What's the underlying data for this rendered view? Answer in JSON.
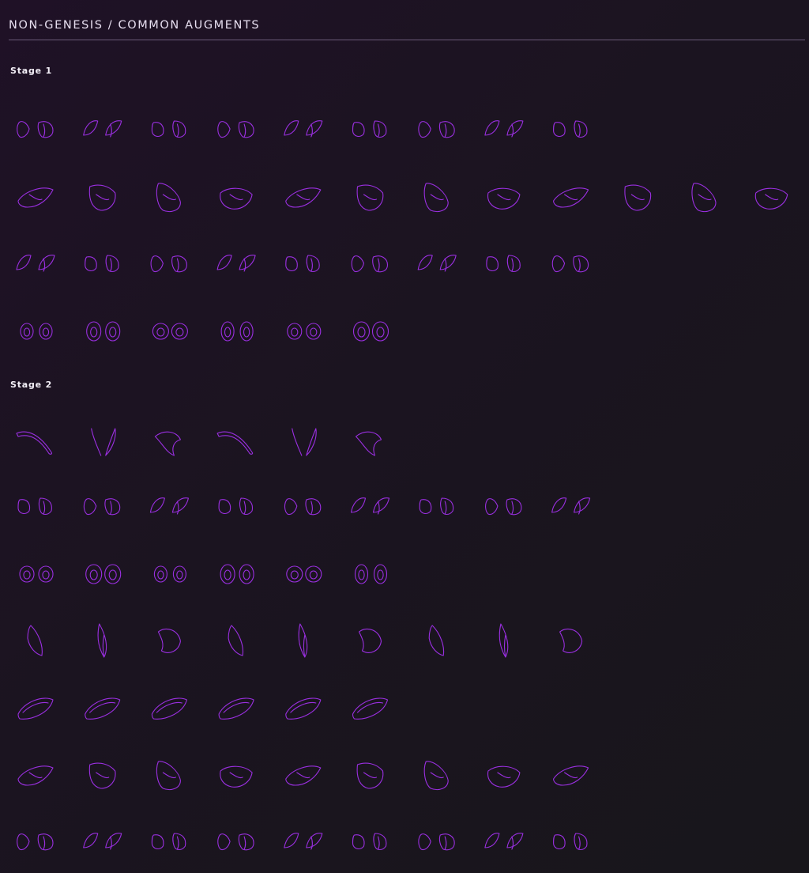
{
  "header": {
    "title": "NON-GENESIS / COMMON AUGMENTS"
  },
  "stages": [
    {
      "label": "Stage 1",
      "rows": [
        {
          "kind": "ear-pair",
          "count": 9
        },
        {
          "kind": "blob",
          "count": 12
        },
        {
          "kind": "ear-pair",
          "count": 9
        },
        {
          "kind": "eye-pair",
          "count": 6
        }
      ]
    },
    {
      "label": "Stage 2",
      "rows": [
        {
          "kind": "antenna",
          "count": 6
        },
        {
          "kind": "ear-pair",
          "count": 9
        },
        {
          "kind": "eye-pair",
          "count": 6
        },
        {
          "kind": "fin",
          "count": 9
        },
        {
          "kind": "lens",
          "count": 6
        },
        {
          "kind": "blob",
          "count": 9
        },
        {
          "kind": "ear-pair",
          "count": 9
        }
      ]
    }
  ],
  "colors": {
    "stroke": "#9a2fe0",
    "text": "#e7dff0",
    "rule": "#6a5a78"
  }
}
